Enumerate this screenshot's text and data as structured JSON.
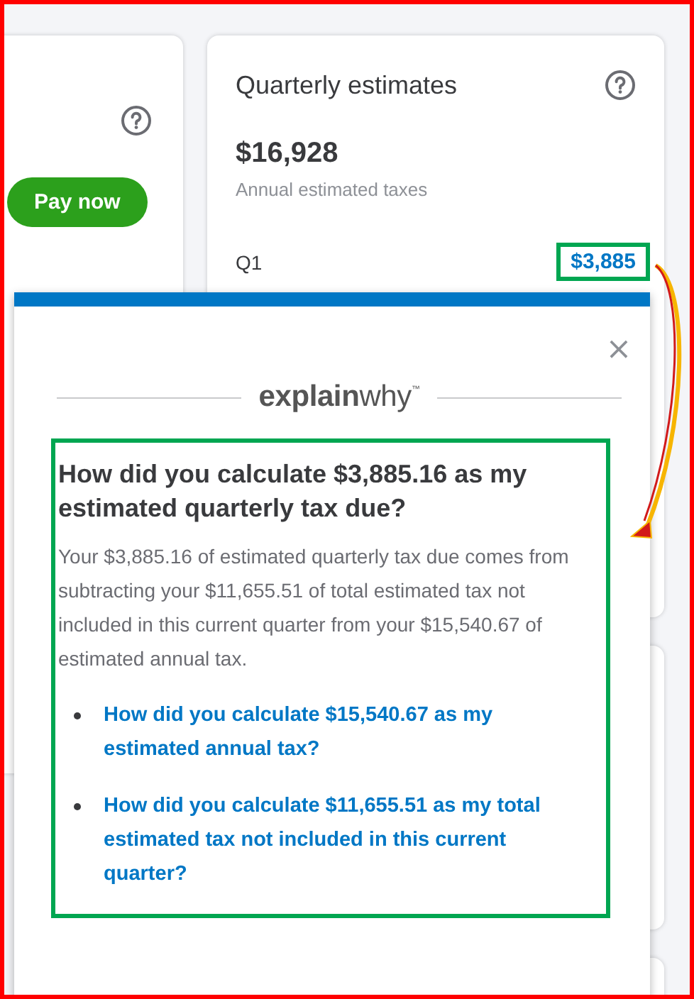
{
  "left_card": {
    "button": "Pay now"
  },
  "quarterly_card": {
    "title": "Quarterly estimates",
    "amount": "$16,928",
    "amount_label": "Annual estimated taxes",
    "quarter": "Q1",
    "quarter_amount": "$3,885"
  },
  "popup": {
    "close": "×",
    "logo_bold": "explain",
    "logo_light": "why",
    "logo_mark": "™",
    "question": "How did you calculate $3,885.16 as my estimated quarterly tax due?",
    "answer": "Your $3,885.16 of estimated quarterly tax due comes from subtracting your $11,655.51 of total estimated tax not included in this current quarter from your $15,540.67 of estimated annual tax.",
    "links": [
      "How did you calculate $15,540.67 as my estimated annual tax?",
      "How did you calculate $11,655.51 as my total estimated tax not included in this current quarter?"
    ]
  }
}
